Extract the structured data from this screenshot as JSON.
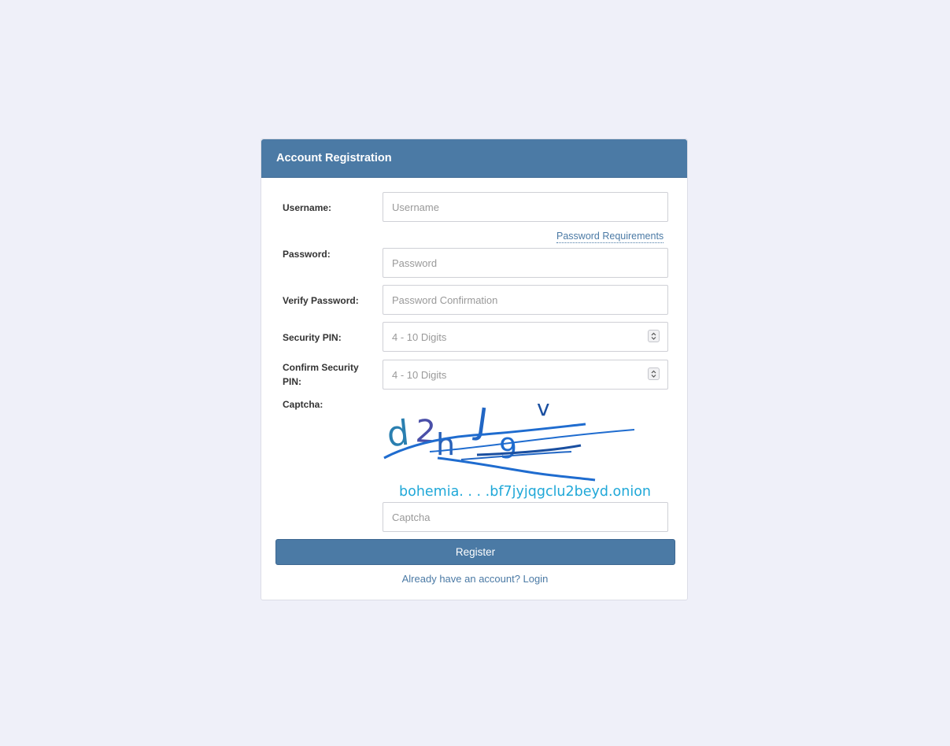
{
  "panel": {
    "title": "Account Registration"
  },
  "form": {
    "username": {
      "label": "Username:",
      "placeholder": "Username"
    },
    "password_requirements_link": "Password Requirements",
    "password": {
      "label": "Password:",
      "placeholder": "Password"
    },
    "verify_password": {
      "label": "Verify Password:",
      "placeholder": "Password Confirmation"
    },
    "security_pin": {
      "label": "Security PIN:",
      "placeholder": "4 - 10 Digits"
    },
    "confirm_security_pin": {
      "label": "Confirm Security PIN:",
      "placeholder": "4 - 10 Digits"
    },
    "captcha": {
      "label": "Captcha:",
      "image_text": "bohemia. . . .bf7jyjqgclu2beyd.onion",
      "placeholder": "Captcha"
    },
    "register_label": "Register",
    "login_link": "Already have an account? Login"
  },
  "colors": {
    "page_bg": "#eff0f9",
    "accent": "#4b7aa5",
    "captcha_text": "#20a8d8"
  }
}
